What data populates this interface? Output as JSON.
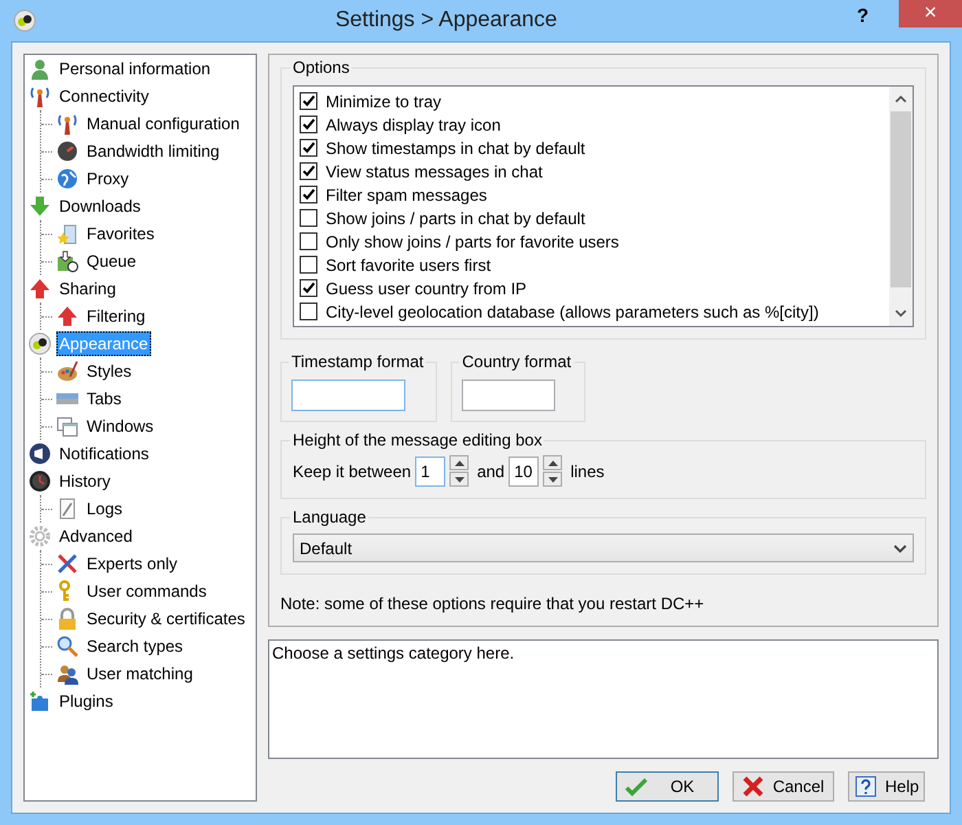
{
  "window": {
    "title": "Settings > Appearance",
    "help": "?",
    "close": "×"
  },
  "tree": [
    {
      "label": "Personal information",
      "kind": "person",
      "selected": false
    },
    {
      "label": "Connectivity",
      "kind": "antenna",
      "selected": false,
      "children": [
        {
          "label": "Manual configuration",
          "kind": "antenna",
          "selected": false
        },
        {
          "label": "Bandwidth limiting",
          "kind": "gauge",
          "selected": false
        },
        {
          "label": "Proxy",
          "kind": "globe",
          "selected": false
        }
      ]
    },
    {
      "label": "Downloads",
      "kind": "down",
      "selected": false,
      "children": [
        {
          "label": "Favorites",
          "kind": "favorites",
          "selected": false
        },
        {
          "label": "Queue",
          "kind": "queue",
          "selected": false
        }
      ]
    },
    {
      "label": "Sharing",
      "kind": "up",
      "selected": false,
      "children": [
        {
          "label": "Filtering",
          "kind": "up",
          "selected": false
        }
      ]
    },
    {
      "label": "Appearance",
      "kind": "ball",
      "selected": true,
      "children": [
        {
          "label": "Styles",
          "kind": "palette",
          "selected": false
        },
        {
          "label": "Tabs",
          "kind": "tabs",
          "selected": false
        },
        {
          "label": "Windows",
          "kind": "windows",
          "selected": false
        }
      ]
    },
    {
      "label": "Notifications",
      "kind": "megaphone",
      "selected": false
    },
    {
      "label": "History",
      "kind": "clock",
      "selected": false,
      "children": [
        {
          "label": "Logs",
          "kind": "page",
          "selected": false
        }
      ]
    },
    {
      "label": "Advanced",
      "kind": "gear",
      "selected": false,
      "children": [
        {
          "label": "Experts only",
          "kind": "tools",
          "selected": false
        },
        {
          "label": "User commands",
          "kind": "key",
          "selected": false
        },
        {
          "label": "Security & certificates",
          "kind": "lock",
          "selected": false
        },
        {
          "label": "Search types",
          "kind": "search",
          "selected": false
        },
        {
          "label": "User matching",
          "kind": "users",
          "selected": false
        }
      ]
    },
    {
      "label": "Plugins",
      "kind": "puzzle",
      "selected": false
    }
  ],
  "options": {
    "title": "Options",
    "items": [
      {
        "label": "Minimize to tray",
        "checked": true
      },
      {
        "label": "Always display tray icon",
        "checked": true
      },
      {
        "label": "Show timestamps in chat by default",
        "checked": true
      },
      {
        "label": "View status messages in chat",
        "checked": true
      },
      {
        "label": "Filter spam messages",
        "checked": true
      },
      {
        "label": "Show joins / parts in chat by default",
        "checked": false
      },
      {
        "label": "Only show joins / parts for favorite users",
        "checked": false
      },
      {
        "label": "Sort favorite users first",
        "checked": false
      },
      {
        "label": "Guess user country from IP",
        "checked": true
      },
      {
        "label": "City-level geolocation database (allows parameters such as %[city])",
        "checked": false
      }
    ]
  },
  "formats": [
    {
      "title": "Timestamp format",
      "focused": true
    },
    {
      "title": "Country format",
      "focused": false
    }
  ],
  "message_box_height": {
    "title": "Height of the message editing box",
    "prefix": "Keep it between",
    "min": {
      "value": "1",
      "focused": true
    },
    "conjunction": "and",
    "max": {
      "value": "10",
      "focused": false
    },
    "suffix": "lines"
  },
  "language": {
    "title": "Language",
    "value": "Default"
  },
  "note": "Note: some of these options require that you restart DC++",
  "description": "Choose a settings category here.",
  "buttons": [
    {
      "label": "OK",
      "kind": "ok",
      "default": true
    },
    {
      "label": "Cancel",
      "kind": "cancel",
      "default": false
    },
    {
      "label": "Help",
      "kind": "help",
      "default": false
    }
  ]
}
